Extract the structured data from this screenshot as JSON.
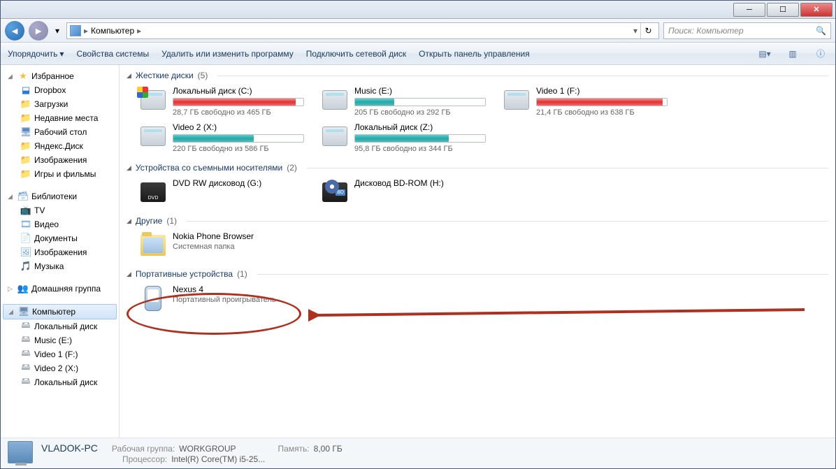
{
  "breadcrumb": {
    "root": "Компьютер"
  },
  "search": {
    "placeholder": "Поиск: Компьютер"
  },
  "toolbar": {
    "organize": "Упорядочить",
    "props": "Свойства системы",
    "uninstall": "Удалить или изменить программу",
    "netdrive": "Подключить сетевой диск",
    "panel": "Открыть панель управления"
  },
  "sidebar": {
    "favorites": "Избранное",
    "fav": [
      "Dropbox",
      "Загрузки",
      "Недавние места",
      "Рабочий стол",
      "Яндекс.Диск",
      "Изображения",
      "Игры и фильмы"
    ],
    "libraries": "Библиотеки",
    "lib": [
      "TV",
      "Видео",
      "Документы",
      "Изображения",
      "Музыка"
    ],
    "homegroup": "Домашняя группа",
    "computer": "Компьютер",
    "drives": [
      "Локальный диск",
      "Music (E:)",
      "Video 1 (F:)",
      "Video 2 (X:)",
      "Локальный диск"
    ]
  },
  "groups": {
    "hdd": {
      "title": "Жесткие диски",
      "count": "(5)"
    },
    "removable": {
      "title": "Устройства со съемными носителями",
      "count": "(2)"
    },
    "other": {
      "title": "Другие",
      "count": "(1)"
    },
    "portable": {
      "title": "Портативные устройства",
      "count": "(1)"
    }
  },
  "disks": [
    {
      "name": "Локальный диск (C:)",
      "sub": "28,7 ГБ свободно из 465 ГБ",
      "color": "red",
      "pct": 94
    },
    {
      "name": "Music (E:)",
      "sub": "205 ГБ свободно из 292 ГБ",
      "color": "teal",
      "pct": 30
    },
    {
      "name": "Video 1 (F:)",
      "sub": "21,4 ГБ свободно из 638 ГБ",
      "color": "red",
      "pct": 97
    },
    {
      "name": "Video 2 (X:)",
      "sub": "220 ГБ свободно из 586 ГБ",
      "color": "teal",
      "pct": 62
    },
    {
      "name": "Локальный диск (Z:)",
      "sub": "95,8 ГБ свободно из 344 ГБ",
      "color": "teal",
      "pct": 72
    }
  ],
  "removable": [
    {
      "name": "DVD RW дисковод (G:)"
    },
    {
      "name": "Дисковод BD-ROM (H:)"
    }
  ],
  "other": [
    {
      "name": "Nokia Phone Browser",
      "sub": "Системная папка"
    }
  ],
  "portable": [
    {
      "name": "Nexus 4",
      "sub": "Портативный проигрыватель"
    }
  ],
  "status": {
    "pc": "VLADOK-PC",
    "wg_label": "Рабочая группа:",
    "wg": "WORKGROUP",
    "mem_label": "Память:",
    "mem": "8,00 ГБ",
    "cpu_label": "Процессор:",
    "cpu": "Intel(R) Core(TM) i5-25..."
  }
}
